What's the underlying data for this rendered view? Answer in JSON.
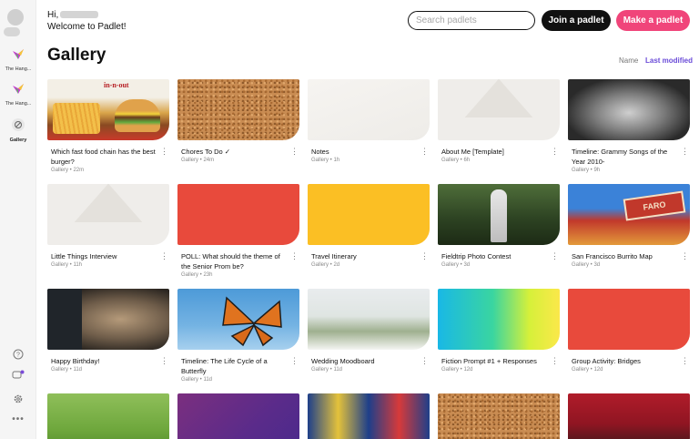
{
  "sidebar": {
    "items": [
      {
        "label": "The Hang..."
      },
      {
        "label": "The Hang..."
      },
      {
        "label": "Gallery"
      }
    ],
    "bottom_icons": [
      "help-icon",
      "notifications-icon",
      "settings-icon",
      "more-icon"
    ]
  },
  "header": {
    "greeting_hi": "Hi,",
    "greeting_welcome": "Welcome to Padlet!",
    "search_placeholder": "Search padlets",
    "join_label": "Join a padlet",
    "make_label": "Make a padlet"
  },
  "page": {
    "title": "Gallery",
    "sort_name": "Name",
    "sort_last": "Last modified"
  },
  "colors": {
    "accent_pink": "#f0457a",
    "accent_purple": "#6a4bd8"
  },
  "cards": [
    {
      "title": "Which fast food chain has the best burger?",
      "meta": "Gallery • 22m"
    },
    {
      "title": "Chores To Do ✓",
      "meta": "Gallery • 24m"
    },
    {
      "title": "Notes",
      "meta": "Gallery • 1h"
    },
    {
      "title": "About Me [Template]",
      "meta": "Gallery • 6h"
    },
    {
      "title": "Timeline: Grammy Songs of the Year 2010-",
      "meta": "Gallery • 9h"
    },
    {
      "title": "Little Things Interview",
      "meta": "Gallery • 11h"
    },
    {
      "title": "POLL: What should the theme of the Senior Prom be?",
      "meta": "Gallery • 23h"
    },
    {
      "title": "Travel Itinerary",
      "meta": "Gallery • 2d"
    },
    {
      "title": "Fieldtrip Photo Contest",
      "meta": "Gallery • 3d"
    },
    {
      "title": "San Francisco Burrito Map",
      "meta": "Gallery • 3d"
    },
    {
      "title": "Happy Birthday!",
      "meta": "Gallery • 11d"
    },
    {
      "title": "Timeline: The Life Cycle of a Butterfly",
      "meta": "Gallery • 11d"
    },
    {
      "title": "Wedding Moodboard",
      "meta": "Gallery • 11d"
    },
    {
      "title": "Fiction Prompt #1 + Responses",
      "meta": "Gallery • 12d"
    },
    {
      "title": "Group Activity: Bridges",
      "meta": "Gallery • 12d"
    }
  ],
  "thumb_label_food_sign": "in-n-out",
  "thumb_label_burrito_sign": "FARO"
}
